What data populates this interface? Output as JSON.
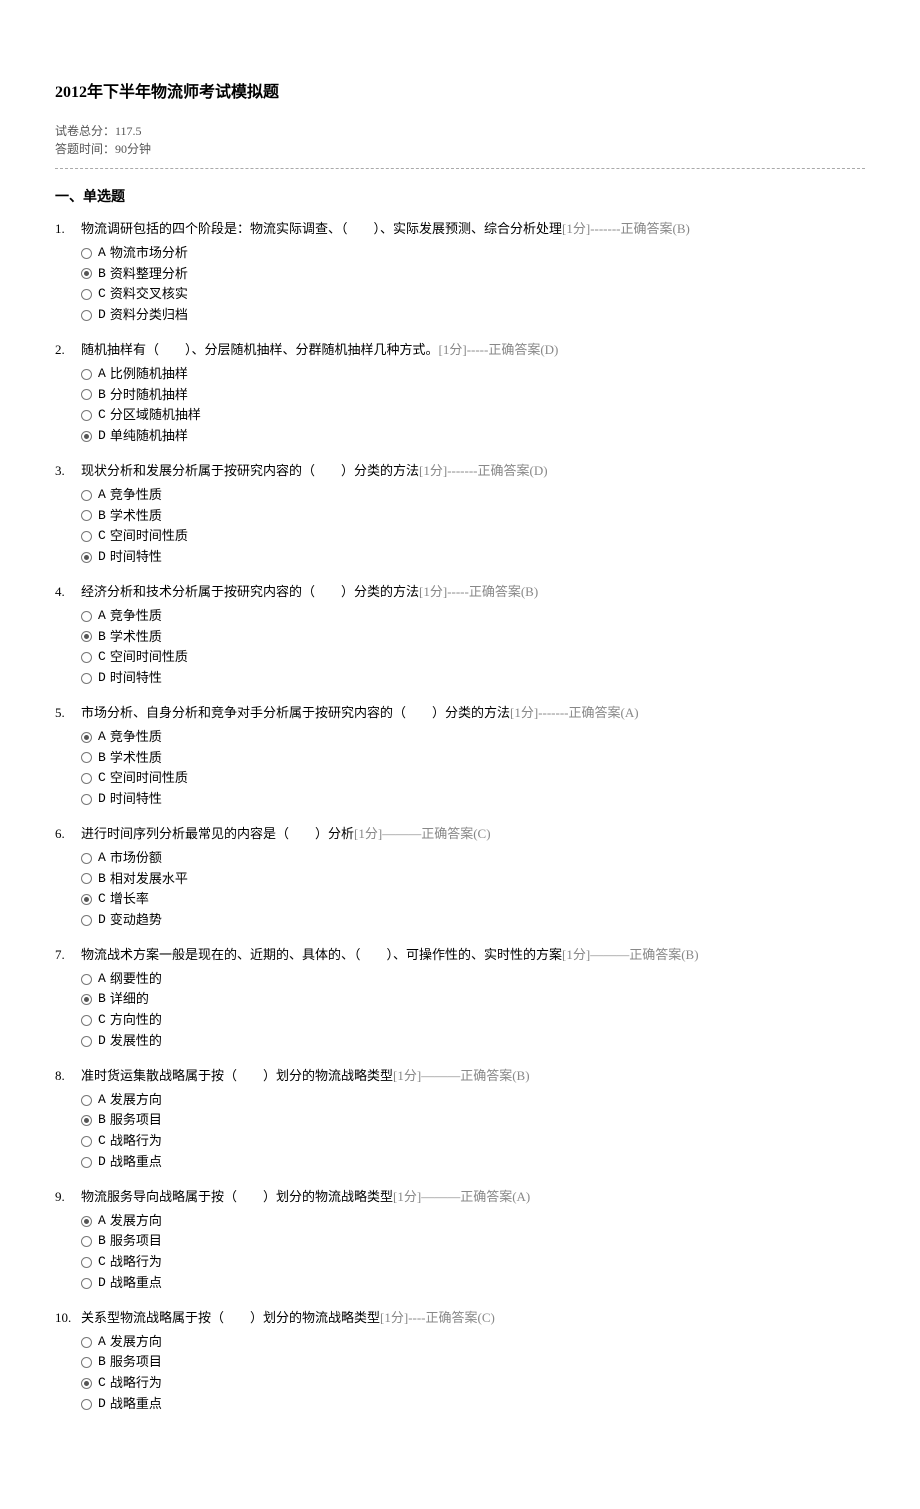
{
  "title": "2012年下半年物流师考试模拟题",
  "meta": {
    "total_score": "试卷总分：117.5",
    "time_limit": "答题时间：90分钟"
  },
  "section_title": "一、单选题",
  "questions": [
    {
      "num": "1.",
      "text": "物流调研包括的四个阶段是：物流实际调查、（　　）、实际发展预测、综合分析处理",
      "score": "[1分]",
      "dashes": "-------",
      "answer": "正确答案(B)",
      "options": [
        {
          "label": "A",
          "text": "物流市场分析",
          "selected": false
        },
        {
          "label": "B",
          "text": "资料整理分析",
          "selected": true
        },
        {
          "label": "C",
          "text": "资料交叉核实",
          "selected": false
        },
        {
          "label": "D",
          "text": "资料分类归档",
          "selected": false
        }
      ]
    },
    {
      "num": "2.",
      "text": "随机抽样有（　　）、分层随机抽样、分群随机抽样几种方式。",
      "score": "[1分]",
      "dashes": "-----",
      "answer": "正确答案(D)",
      "options": [
        {
          "label": "A",
          "text": "比例随机抽样",
          "selected": false
        },
        {
          "label": "B",
          "text": "分时随机抽样",
          "selected": false
        },
        {
          "label": "C",
          "text": "分区域随机抽样",
          "selected": false
        },
        {
          "label": "D",
          "text": "单纯随机抽样",
          "selected": true
        }
      ]
    },
    {
      "num": "3.",
      "text": "现状分析和发展分析属于按研究内容的（　　）分类的方法",
      "score": "[1分]",
      "dashes": "-------",
      "answer": "正确答案(D)",
      "options": [
        {
          "label": "A",
          "text": "竞争性质",
          "selected": false
        },
        {
          "label": "B",
          "text": "学术性质",
          "selected": false
        },
        {
          "label": "C",
          "text": "空间时间性质",
          "selected": false
        },
        {
          "label": "D",
          "text": "时间特性",
          "selected": true
        }
      ]
    },
    {
      "num": "4.",
      "text": "经济分析和技术分析属于按研究内容的（　　）分类的方法",
      "score": "[1分]",
      "dashes": "-----",
      "answer": "正确答案(B)",
      "options": [
        {
          "label": "A",
          "text": "竞争性质",
          "selected": false
        },
        {
          "label": "B",
          "text": "学术性质",
          "selected": true
        },
        {
          "label": "C",
          "text": "空间时间性质",
          "selected": false
        },
        {
          "label": "D",
          "text": "时间特性",
          "selected": false
        }
      ]
    },
    {
      "num": "5.",
      "text": "市场分析、自身分析和竞争对手分析属于按研究内容的（　　）分类的方法",
      "score": "[1分]",
      "dashes": "-------",
      "answer": "正确答案(A)",
      "options": [
        {
          "label": "A",
          "text": "竞争性质",
          "selected": true
        },
        {
          "label": "B",
          "text": "学术性质",
          "selected": false
        },
        {
          "label": "C",
          "text": "空间时间性质",
          "selected": false
        },
        {
          "label": "D",
          "text": "时间特性",
          "selected": false
        }
      ]
    },
    {
      "num": "6.",
      "text": "进行时间序列分析最常见的内容是（　　）分析",
      "score": "[1分]",
      "dashes": "———",
      "answer": "正确答案(C)",
      "options": [
        {
          "label": "A",
          "text": "市场份额",
          "selected": false
        },
        {
          "label": "B",
          "text": "相对发展水平",
          "selected": false
        },
        {
          "label": "C",
          "text": "增长率",
          "selected": true
        },
        {
          "label": "D",
          "text": "变动趋势",
          "selected": false
        }
      ]
    },
    {
      "num": "7.",
      "text": "物流战术方案一般是现在的、近期的、具体的、（　　）、可操作性的、实时性的方案",
      "score": "[1分]",
      "dashes": "———",
      "answer": "正确答案(B)",
      "options": [
        {
          "label": "A",
          "text": "纲要性的",
          "selected": false
        },
        {
          "label": "B",
          "text": "详细的",
          "selected": true
        },
        {
          "label": "C",
          "text": "方向性的",
          "selected": false
        },
        {
          "label": "D",
          "text": "发展性的",
          "selected": false
        }
      ]
    },
    {
      "num": "8.",
      "text": "准时货运集散战略属于按（　　）划分的物流战略类型",
      "score": "[1分]",
      "dashes": "———",
      "answer": "正确答案(B)",
      "options": [
        {
          "label": "A",
          "text": "发展方向",
          "selected": false
        },
        {
          "label": "B",
          "text": "服务项目",
          "selected": true
        },
        {
          "label": "C",
          "text": "战略行为",
          "selected": false
        },
        {
          "label": "D",
          "text": "战略重点",
          "selected": false
        }
      ]
    },
    {
      "num": "9.",
      "text": "物流服务导向战略属于按（　　）划分的物流战略类型",
      "score": "[1分]",
      "dashes": "———",
      "answer": "正确答案(A)",
      "options": [
        {
          "label": "A",
          "text": "发展方向",
          "selected": true
        },
        {
          "label": "B",
          "text": "服务项目",
          "selected": false
        },
        {
          "label": "C",
          "text": "战略行为",
          "selected": false
        },
        {
          "label": "D",
          "text": "战略重点",
          "selected": false
        }
      ]
    },
    {
      "num": "10.",
      "text": "关系型物流战略属于按（　　）划分的物流战略类型",
      "score": "[1分]",
      "dashes": "----",
      "answer": "正确答案(C)",
      "options": [
        {
          "label": "A",
          "text": "发展方向",
          "selected": false
        },
        {
          "label": "B",
          "text": "服务项目",
          "selected": false
        },
        {
          "label": "C",
          "text": "战略行为",
          "selected": true
        },
        {
          "label": "D",
          "text": "战略重点",
          "selected": false
        }
      ]
    }
  ]
}
